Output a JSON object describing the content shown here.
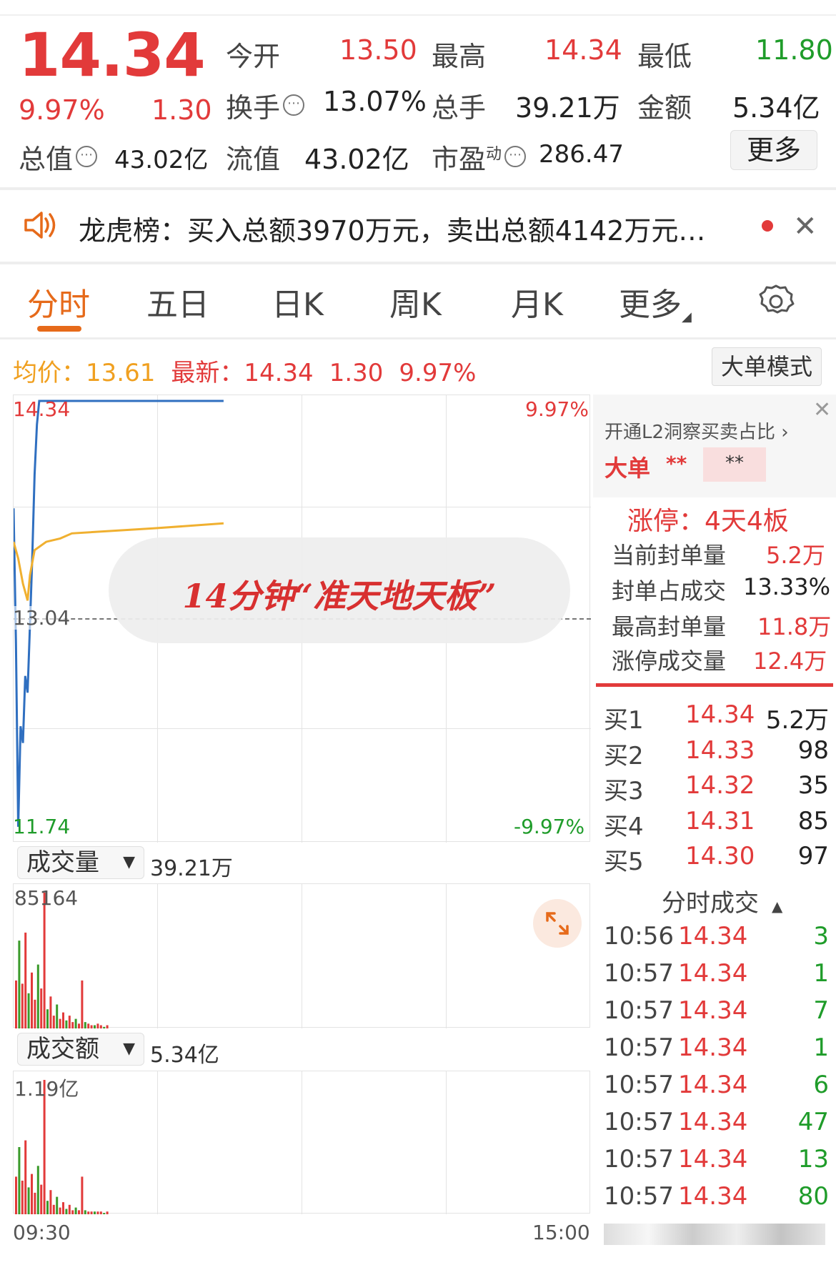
{
  "quote": {
    "price": "14.34",
    "change_pct": "9.97%",
    "change": "1.30",
    "open_label": "今开",
    "open": "13.50",
    "high_label": "最高",
    "high": "14.34",
    "low_label": "最低",
    "low": "11.80",
    "turnover_label": "换手",
    "turnover": "13.07%",
    "volume_label": "总手",
    "volume": "39.21万",
    "amount_label": "金额",
    "amount": "5.34亿",
    "mktcap_label": "总值",
    "mktcap": "43.02亿",
    "float_label": "流值",
    "float": "43.02亿",
    "pe_label": "市盈",
    "pe_sup": "动",
    "pe": "286.47",
    "more_button": "更多"
  },
  "notice": {
    "text": "龙虎榜：买入总额3970万元，卖出总额4142万元…"
  },
  "tabs": [
    "分时",
    "五日",
    "日K",
    "周K",
    "月K",
    "更多"
  ],
  "active_tab": 0,
  "summary": {
    "avg_label": "均价：",
    "avg": "13.61",
    "latest_label": "最新：",
    "latest": "14.34",
    "change": "1.30",
    "change_pct": "9.97%",
    "big_order_button": "大单模式"
  },
  "chart": {
    "y_top": "14.34",
    "y_mid": "13.04",
    "y_bottom": "11.74",
    "pct_top": "9.97%",
    "pct_bottom": "-9.97%",
    "overlay_caption": "14分钟“准天地天板”",
    "volume_select": "成交量",
    "volume_total": "39.21万",
    "volume_max": "85164",
    "amount_select": "成交额",
    "amount_total": "5.34亿",
    "amount_max": "1.19亿",
    "time_start": "09:30",
    "time_end": "15:00"
  },
  "chart_data": {
    "type": "line",
    "series": [
      {
        "name": "",
        "color": "#2f6fc0",
        "points": [
          [
            0,
            13.7
          ],
          [
            1,
            12.9
          ],
          [
            2,
            11.8
          ],
          [
            3,
            12.4
          ],
          [
            4,
            12.3
          ],
          [
            5,
            12.7
          ],
          [
            6,
            12.6
          ],
          [
            7,
            13.0
          ],
          [
            8,
            13.4
          ],
          [
            9,
            13.9
          ],
          [
            10,
            14.2
          ],
          [
            11,
            14.34
          ],
          [
            12,
            14.34
          ],
          [
            90,
            14.34
          ]
        ]
      },
      {
        "name": "",
        "color": "#f0b030",
        "points": [
          [
            0,
            13.5
          ],
          [
            2,
            13.4
          ],
          [
            4,
            13.25
          ],
          [
            6,
            13.15
          ],
          [
            7,
            13.3
          ],
          [
            9,
            13.45
          ],
          [
            14,
            13.5
          ],
          [
            20,
            13.52
          ],
          [
            25,
            13.55
          ],
          [
            60,
            13.58
          ],
          [
            90,
            13.61
          ]
        ]
      }
    ],
    "x_range": [
      0,
      240
    ],
    "y_range": [
      11.74,
      14.34
    ],
    "volume_bars": [
      30,
      55,
      28,
      60,
      22,
      35,
      18,
      40,
      25,
      85,
      12,
      20,
      8,
      15,
      6,
      10,
      5,
      8,
      4,
      6,
      3,
      30,
      4,
      3,
      2,
      2,
      3,
      2,
      1,
      2
    ],
    "amount_bars": [
      28,
      50,
      25,
      55,
      20,
      30,
      16,
      36,
      22,
      100,
      10,
      18,
      7,
      13,
      5,
      9,
      4,
      7,
      3,
      5,
      3,
      28,
      3,
      2,
      2,
      2,
      2,
      2,
      1,
      2
    ]
  },
  "side": {
    "l2_link": "开通L2洞察买卖占比",
    "big_label": "大单",
    "big_val1": "**",
    "big_val2": "**",
    "limit_title": "涨停：4天4板",
    "rows": [
      {
        "label": "当前封单量",
        "value": "5.2万"
      },
      {
        "label": "封单占成交",
        "value": "13.33%"
      },
      {
        "label": "最高封单量",
        "value": "11.8万"
      },
      {
        "label": "涨停成交量",
        "value": "12.4万"
      }
    ],
    "order_book": [
      {
        "label": "买1",
        "price": "14.34",
        "qty": "5.2万"
      },
      {
        "label": "买2",
        "price": "14.33",
        "qty": "98"
      },
      {
        "label": "买3",
        "price": "14.32",
        "qty": "35"
      },
      {
        "label": "买4",
        "price": "14.31",
        "qty": "85"
      },
      {
        "label": "买5",
        "price": "14.30",
        "qty": "97"
      }
    ],
    "trades_title": "分时成交",
    "trades": [
      {
        "time": "10:56",
        "price": "14.34",
        "qty": "3"
      },
      {
        "time": "10:57",
        "price": "14.34",
        "qty": "1"
      },
      {
        "time": "10:57",
        "price": "14.34",
        "qty": "7"
      },
      {
        "time": "10:57",
        "price": "14.34",
        "qty": "1"
      },
      {
        "time": "10:57",
        "price": "14.34",
        "qty": "6"
      },
      {
        "time": "10:57",
        "price": "14.34",
        "qty": "47"
      },
      {
        "time": "10:57",
        "price": "14.34",
        "qty": "13"
      },
      {
        "time": "10:57",
        "price": "14.34",
        "qty": "80"
      }
    ]
  }
}
